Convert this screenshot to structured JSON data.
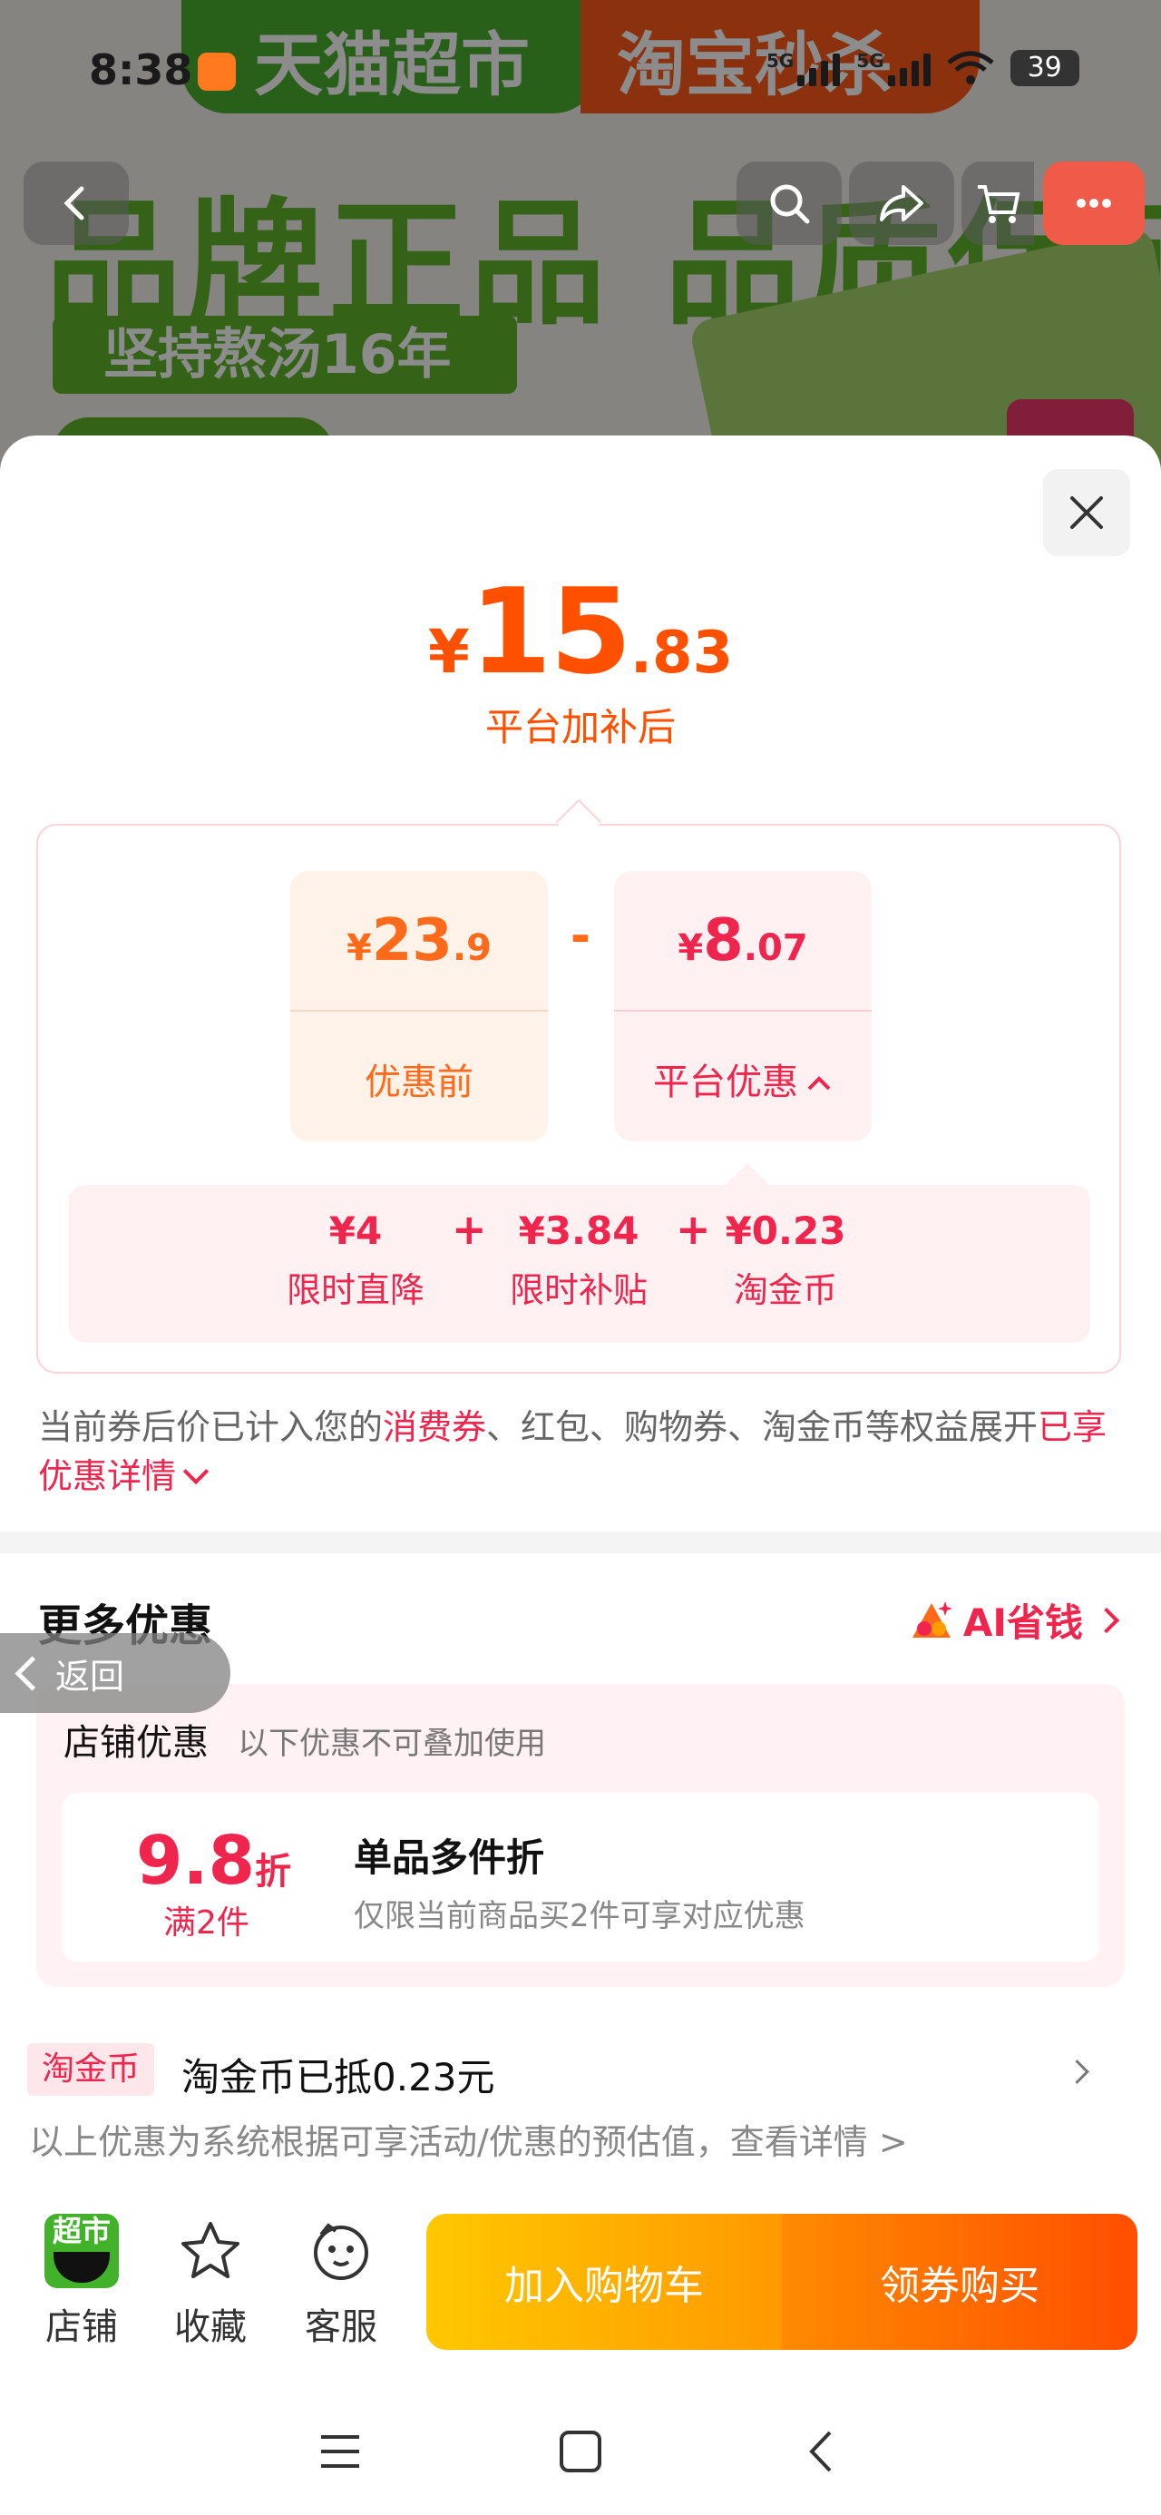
{
  "status_bar": {
    "time": "8:38",
    "net_1": "5G",
    "net_2": "5G",
    "battery": "39"
  },
  "background": {
    "banner_left": "天猫超市",
    "banner_right": "淘宝秒杀",
    "headline": "品牌正品 品质保证",
    "tag": "坚持熬汤16年"
  },
  "price": {
    "currency": "¥",
    "integer": "15",
    "decimal": ".83",
    "label": "平台加补后"
  },
  "calc": {
    "before": {
      "currency": "¥",
      "integer": "23",
      "decimal": ".9",
      "label": "优惠前"
    },
    "minus": "-",
    "platform": {
      "currency": "¥",
      "integer": "8",
      "decimal": ".07",
      "label": "平台优惠"
    }
  },
  "breakdown": {
    "items": [
      {
        "value": "¥4",
        "label": "限时直降"
      },
      {
        "value": "¥3.84",
        "label": "限时补贴"
      },
      {
        "value": "¥0.23",
        "label": "淘金币"
      }
    ],
    "plus": "+"
  },
  "note": {
    "prefix": "当前券后价已计入您的",
    "highlight": "消费券",
    "middle": "、红包、购物券、淘金币等权益展开",
    "link": "已享优惠详情"
  },
  "more": {
    "title": "更多优惠",
    "ai_link": "AI省钱",
    "back": "返回"
  },
  "shop_discount": {
    "title": "店铺优惠",
    "subtitle": "以下优惠不可叠加使用",
    "number": "9.8",
    "unit": "折",
    "condition": "满2件",
    "name": "单品多件折",
    "desc": "仅限当前商品买2件可享对应优惠"
  },
  "coin": {
    "tag": "淘金币",
    "text": "淘金币已抵0.23元"
  },
  "estimate_note": "以上优惠为系统根据可享活动/优惠的预估值，查看详情 >",
  "bottom_bar": {
    "shop_icon_text": "超市",
    "shop": "店铺",
    "fav": "收藏",
    "service": "客服",
    "add_cart": "加入购物车",
    "buy": "领券购买"
  },
  "colors": {
    "price_orange": "#ff5000",
    "discount_red": "#f0254d",
    "cart_button": "#ffb300",
    "buy_button": "#ff6400"
  },
  "icons": [
    "back-icon",
    "search-icon",
    "share-icon",
    "cart-icon",
    "more-icon",
    "close-icon",
    "chevron-up-icon",
    "chevron-down-icon",
    "ai-logo-icon",
    "star-icon",
    "service-icon",
    "menu-icon",
    "home-icon",
    "nav-back-icon"
  ]
}
